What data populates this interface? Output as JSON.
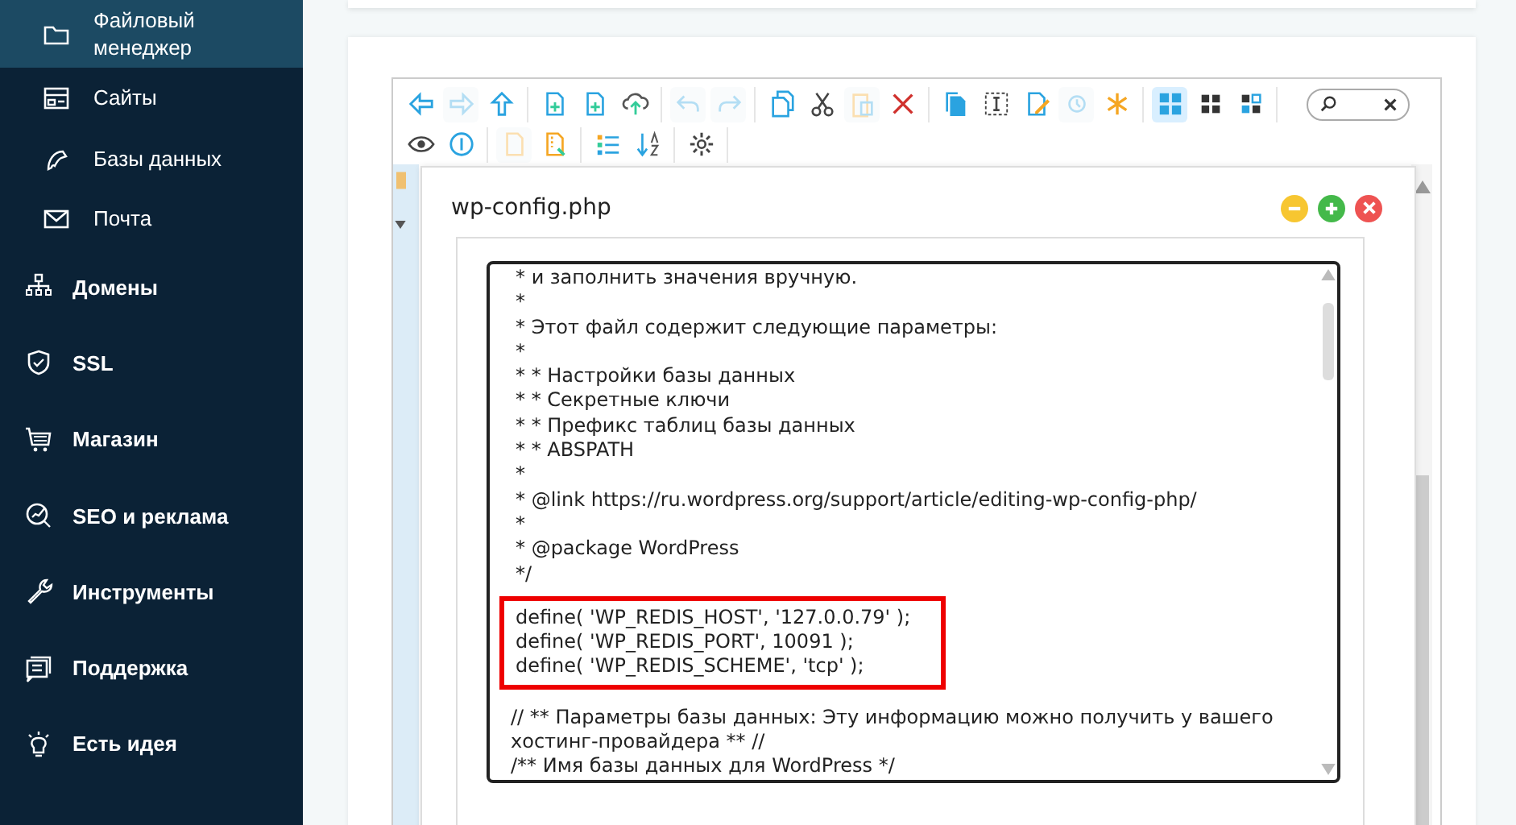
{
  "sidebar": {
    "items": [
      {
        "label": "Файловый менеджер",
        "kind": "sub",
        "selected": true
      },
      {
        "label": "Сайты",
        "kind": "sub",
        "selected": false
      },
      {
        "label": "Базы данных",
        "kind": "sub",
        "selected": false
      },
      {
        "label": "Почта",
        "kind": "sub",
        "selected": false
      },
      {
        "label": "Домены",
        "kind": "section",
        "selected": false
      },
      {
        "label": "SSL",
        "kind": "section",
        "selected": false
      },
      {
        "label": "Магазин",
        "kind": "section",
        "selected": false
      },
      {
        "label": "SEO и реклама",
        "kind": "section",
        "selected": false
      },
      {
        "label": "Инструменты",
        "kind": "section",
        "selected": false
      },
      {
        "label": "Поддержка",
        "kind": "section",
        "selected": false
      },
      {
        "label": "Есть идея",
        "kind": "section",
        "selected": false
      }
    ]
  },
  "toolbar": {
    "rows": [
      [
        [
          {
            "disabled": false
          },
          {
            "disabled": true
          },
          {
            "disabled": false
          }
        ],
        [
          {
            "disabled": false
          },
          {
            "disabled": false
          },
          {
            "disabled": false
          }
        ],
        [
          {
            "disabled": true
          },
          {
            "disabled": true
          }
        ],
        [
          {
            "disabled": false
          },
          {
            "disabled": false
          },
          {
            "disabled": true
          },
          {
            "disabled": false
          }
        ],
        [
          {
            "disabled": false
          },
          {
            "disabled": false
          },
          {
            "disabled": false
          },
          {
            "disabled": true
          },
          {
            "disabled": false
          }
        ],
        [
          {
            "disabled": false,
            "selected": true
          },
          {
            "disabled": false,
            "selected": false
          },
          {
            "disabled": false,
            "selected": false
          }
        ]
      ],
      [
        [
          {
            "disabled": false
          },
          {
            "disabled": false
          }
        ],
        [
          {
            "disabled": true
          },
          {
            "disabled": false
          }
        ],
        [
          {
            "disabled": false
          },
          {
            "disabled": false
          }
        ],
        [
          {
            "disabled": false
          }
        ]
      ]
    ]
  },
  "editor_window": {
    "title": "wp-config.php",
    "code": [
      {
        "highlighted": false,
        "lines": [
          "* и заполнить значения вручную.",
          "*",
          "* Этот файл содержит следующие параметры:",
          "*",
          "* * Настройки базы данных",
          "* * Секретные ключи",
          "* * Префикс таблиц базы данных",
          "* * ABSPATH",
          "*",
          "* @link https://ru.wordpress.org/support/article/editing-wp-config-php/",
          "*",
          "* @package WordPress",
          "*/"
        ]
      },
      {
        "highlighted": true,
        "lines": [
          "define( 'WP_REDIS_HOST', '127.0.0.79' );",
          "define( 'WP_REDIS_PORT', 10091 );",
          "define( 'WP_REDIS_SCHEME', 'tcp' );"
        ]
      },
      {
        "highlighted": false,
        "lines": [
          "// ** Параметры базы данных: Эту информацию можно получить у вашего хостинг-провайдера ** //",
          "/** Имя базы данных для WordPress */"
        ]
      }
    ]
  }
}
